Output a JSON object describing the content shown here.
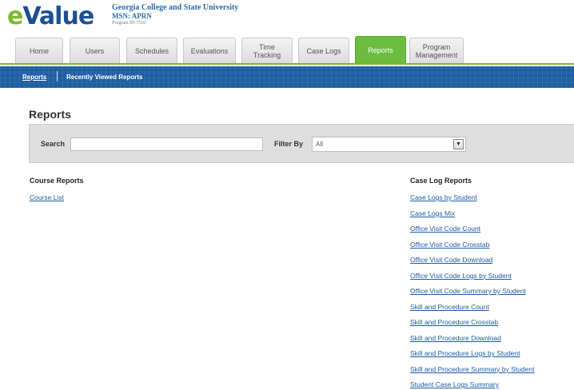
{
  "brand": {
    "logo_e": "e",
    "logo_rest": "Value"
  },
  "institution": {
    "name": "Georgia College and State University",
    "program": "MSN: APRN",
    "program_id": "Program ID:7510"
  },
  "tabs": [
    {
      "label": "Home"
    },
    {
      "label": "Users"
    },
    {
      "label": "Schedules"
    },
    {
      "label": "Evaluations"
    },
    {
      "label": "Time Tracking"
    },
    {
      "label": "Case Logs"
    },
    {
      "label": "Reports",
      "active": true
    },
    {
      "label": "Program Management"
    }
  ],
  "subnav": {
    "reports": "Reports",
    "recent": "Recently Viewed Reports"
  },
  "page_title": "Reports",
  "search": {
    "label": "Search",
    "value": "",
    "placeholder": ""
  },
  "filter": {
    "label": "Filter By",
    "selected": "All"
  },
  "course_reports": {
    "title": "Course Reports",
    "items": [
      "Course List"
    ]
  },
  "case_log_reports": {
    "title": "Case Log Reports",
    "items": [
      "Case Logs by Student",
      "Case Logs Mix",
      "Office Visit Code Count",
      "Office Visit Code Crosstab",
      "Office Visit Code Download",
      "Office Visit Code Logs by Student",
      "Office Visit Code Summary by Student",
      "Skill and Procedure Count",
      "Skill and Procedure Crosstab",
      "Skill and Procedure Download",
      "Skill and Procedure Logs by Student",
      "Skill and Procedure Summary by Student",
      "Student Case Logs Summary"
    ]
  },
  "colors": {
    "accent_green": "#6cbd3f",
    "nav_blue": "#1f5fa3",
    "link_blue": "#1a5aa6"
  }
}
